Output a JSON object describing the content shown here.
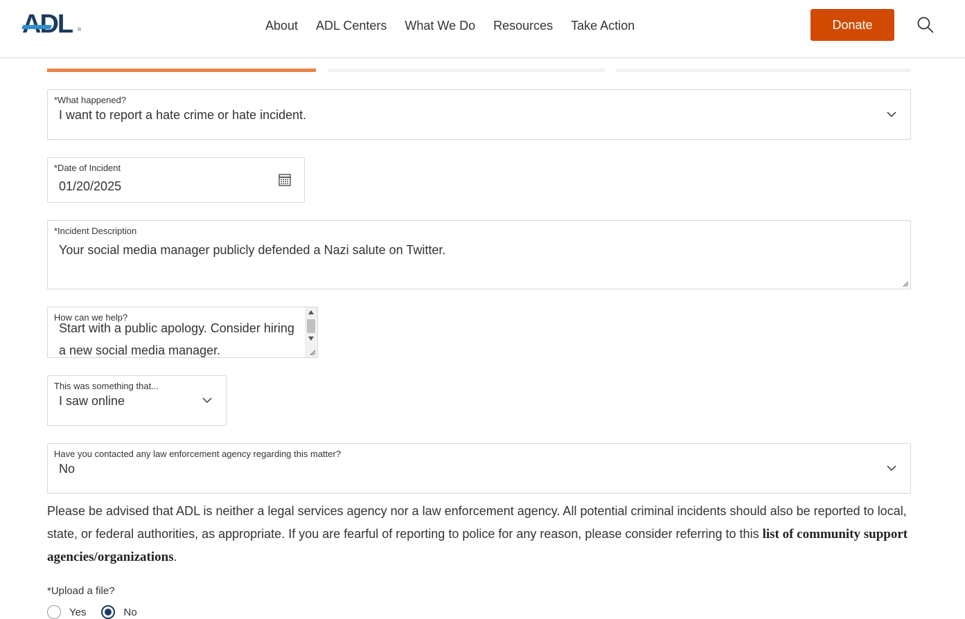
{
  "header": {
    "logo_text": "ADL",
    "logo_reg": "®",
    "nav": [
      "About",
      "ADL Centers",
      "What We Do",
      "Resources",
      "Take Action"
    ],
    "donate_label": "Donate"
  },
  "form": {
    "what_happened": {
      "label": "*What happened?",
      "value": "I want to report a hate crime or hate incident."
    },
    "date": {
      "label": "*Date of Incident",
      "value": "01/20/2025"
    },
    "description": {
      "label": "*Incident Description",
      "value": "Your social media manager publicly defended a Nazi salute on Twitter."
    },
    "help": {
      "label": "How can we help?",
      "value": "Start with a public apology. Consider hiring a new social media manager."
    },
    "something_that": {
      "label": "This was something that...",
      "value": "I saw online"
    },
    "law_enforcement": {
      "label": "Have you contacted any law enforcement agency regarding this matter?",
      "value": "No"
    },
    "advisory": {
      "text": "Please be advised that ADL is neither a legal services agency nor a law enforcement agency.  All potential criminal incidents should also be reported to local, state, or federal authorities, as appropriate. If you are fearful of reporting to police for any reason, please consider referring to this ",
      "link": "list of community support agencies/organizations",
      "suffix": "."
    },
    "upload": {
      "label": "*Upload a file?",
      "options": [
        "Yes",
        "No"
      ],
      "selected": "No"
    }
  },
  "colors": {
    "brand_navy": "#1d3a5f",
    "donate_orange": "#d04a02",
    "progress_active": "#e8834a"
  }
}
